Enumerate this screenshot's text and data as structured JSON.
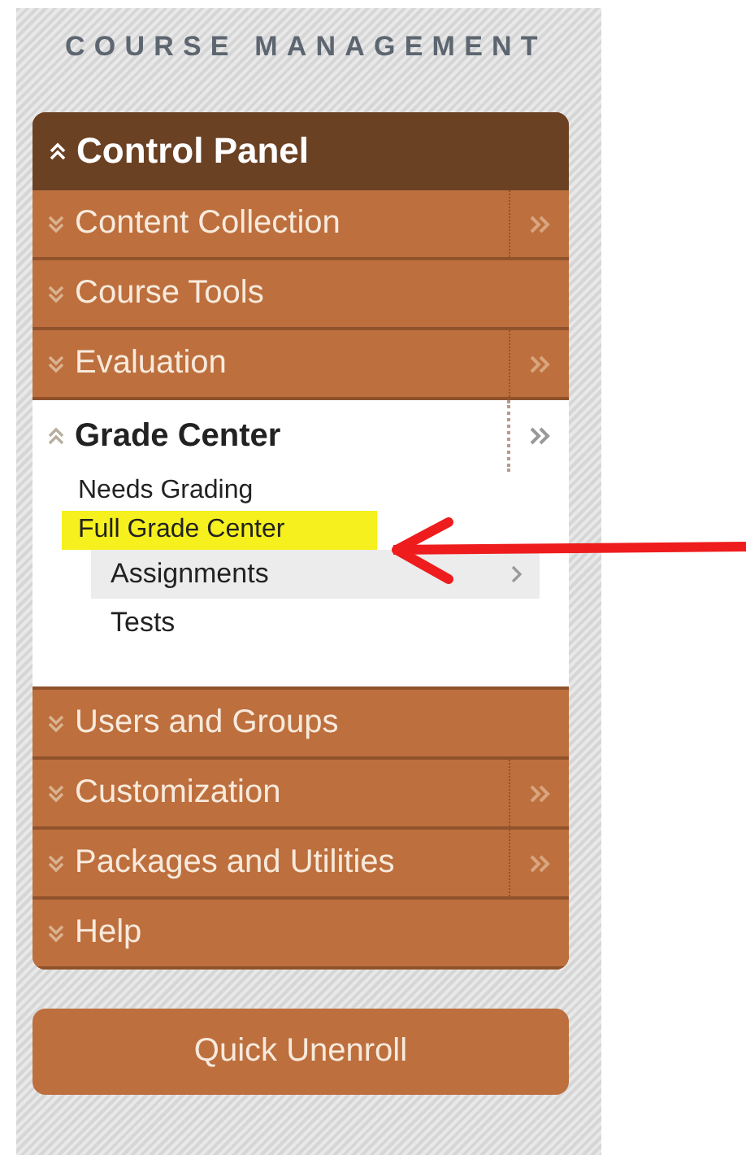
{
  "panel_title": "COURSE MANAGEMENT",
  "control_panel": {
    "label": "Control Panel",
    "expanded": true,
    "sections": [
      {
        "label": "Content Collection",
        "expanded": false,
        "has_menu": true
      },
      {
        "label": "Course Tools",
        "expanded": false,
        "has_menu": false
      },
      {
        "label": "Evaluation",
        "expanded": false,
        "has_menu": true
      },
      {
        "label": "Grade Center",
        "expanded": true,
        "has_menu": true,
        "items": [
          {
            "label": "Needs Grading",
            "highlighted": false,
            "selected": false
          },
          {
            "label": "Full Grade Center",
            "highlighted": true,
            "selected": false,
            "children": [
              {
                "label": "Assignments",
                "selected": true
              },
              {
                "label": "Tests",
                "selected": false
              }
            ]
          }
        ]
      },
      {
        "label": "Users and Groups",
        "expanded": false,
        "has_menu": false
      },
      {
        "label": "Customization",
        "expanded": false,
        "has_menu": true
      },
      {
        "label": "Packages and Utilities",
        "expanded": false,
        "has_menu": true
      },
      {
        "label": "Help",
        "expanded": false,
        "has_menu": false
      }
    ]
  },
  "quick_unenroll": {
    "label": "Quick Unenroll"
  },
  "annotation": {
    "kind": "arrow"
  }
}
